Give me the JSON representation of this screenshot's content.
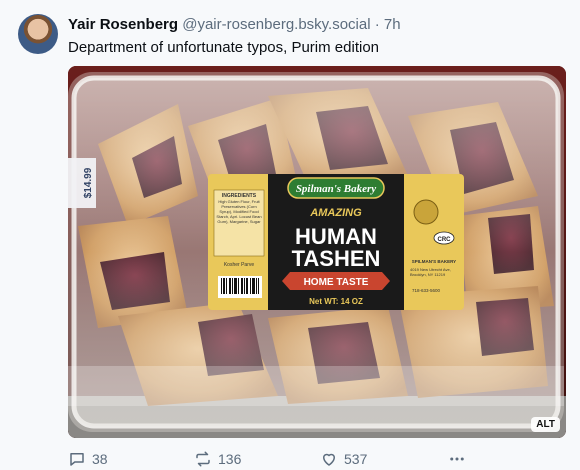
{
  "post": {
    "author_name": "Yair Rosenberg",
    "author_handle": "@yair-rosenberg.bsky.social",
    "separator": "·",
    "time_ago": "7h",
    "text": "Department of unfortunate typos, Purim edition"
  },
  "image": {
    "alt_badge": "ALT",
    "package": {
      "brand": "Spilman's Bakery",
      "tagline": "AMAZING",
      "product_line1": "HUMAN",
      "product_line2": "TASHEN",
      "ribbon": "HOME TASTE",
      "weight": "Net WT: 14 OZ",
      "ingredients_title": "INGREDIENTS",
      "ingredients_text": "High Gluten Flour, Fruit Preservatives (Corn Syrup), Modified Food Starch, Apri. Locust Bean Gum), Margarine, Sugar",
      "kosher": "Kosher Parve",
      "certification": "CRC",
      "right_brand": "SPILMAN'S BAKERY",
      "address": "4019 New Utrecht Ave, Brooklyn, NY 11219",
      "phone": "718-633-5600",
      "price_tag": "$14.99"
    }
  },
  "actions": {
    "reply_count": "38",
    "repost_count": "136",
    "like_count": "537"
  },
  "colors": {
    "label_yellow": "#e9c85a",
    "label_black": "#1a1a1a",
    "ribbon_red": "#c9452f",
    "muted_text": "#5c6c7d"
  }
}
